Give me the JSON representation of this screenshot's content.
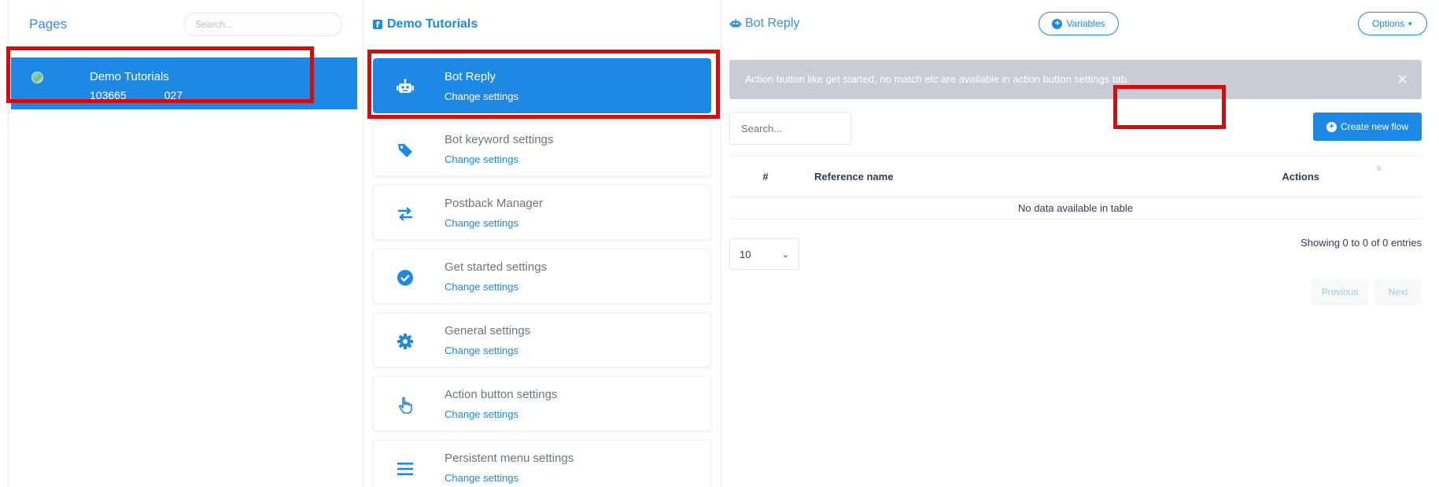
{
  "pages": {
    "title": "Pages",
    "search_placeholder": "Search...",
    "items": [
      {
        "name": "Demo Tutorials",
        "id_prefix": "103665",
        "id_suffix": "027"
      }
    ]
  },
  "settings": {
    "page_title": "Demo Tutorials",
    "items": [
      {
        "title": "Bot Reply",
        "link": "Change settings",
        "icon": "robot-icon",
        "active": true
      },
      {
        "title": "Bot keyword settings",
        "link": "Change settings",
        "icon": "tag-icon"
      },
      {
        "title": "Postback Manager",
        "link": "Change settings",
        "icon": "exchange-icon"
      },
      {
        "title": "Get started settings",
        "link": "Change settings",
        "icon": "check-circle-icon"
      },
      {
        "title": "General settings",
        "link": "Change settings",
        "icon": "gear-icon"
      },
      {
        "title": "Action button settings",
        "link": "Change settings",
        "icon": "hand-pointer-icon"
      },
      {
        "title": "Persistent menu settings",
        "link": "Change settings",
        "icon": "bars-icon"
      }
    ]
  },
  "main": {
    "title": "Bot Reply",
    "variables_label": "Variables",
    "options_label": "Options",
    "alert_text": "Action button like get started, no match etc are available in action button settings tab.",
    "alert_close": "×",
    "search_placeholder": "Search...",
    "create_label": "Create new flow",
    "table": {
      "headers": [
        "#",
        "Reference name",
        "Actions"
      ],
      "empty_text": "No data available in table"
    },
    "page_length": "10",
    "info": "Showing 0 to 0 of 0 entries",
    "prev_label": "Previous",
    "next_label": "Next"
  },
  "colors": {
    "primary": "#1e88e5",
    "highlight_border": "#d10d0d",
    "alert_bg": "#c9ccd4"
  }
}
